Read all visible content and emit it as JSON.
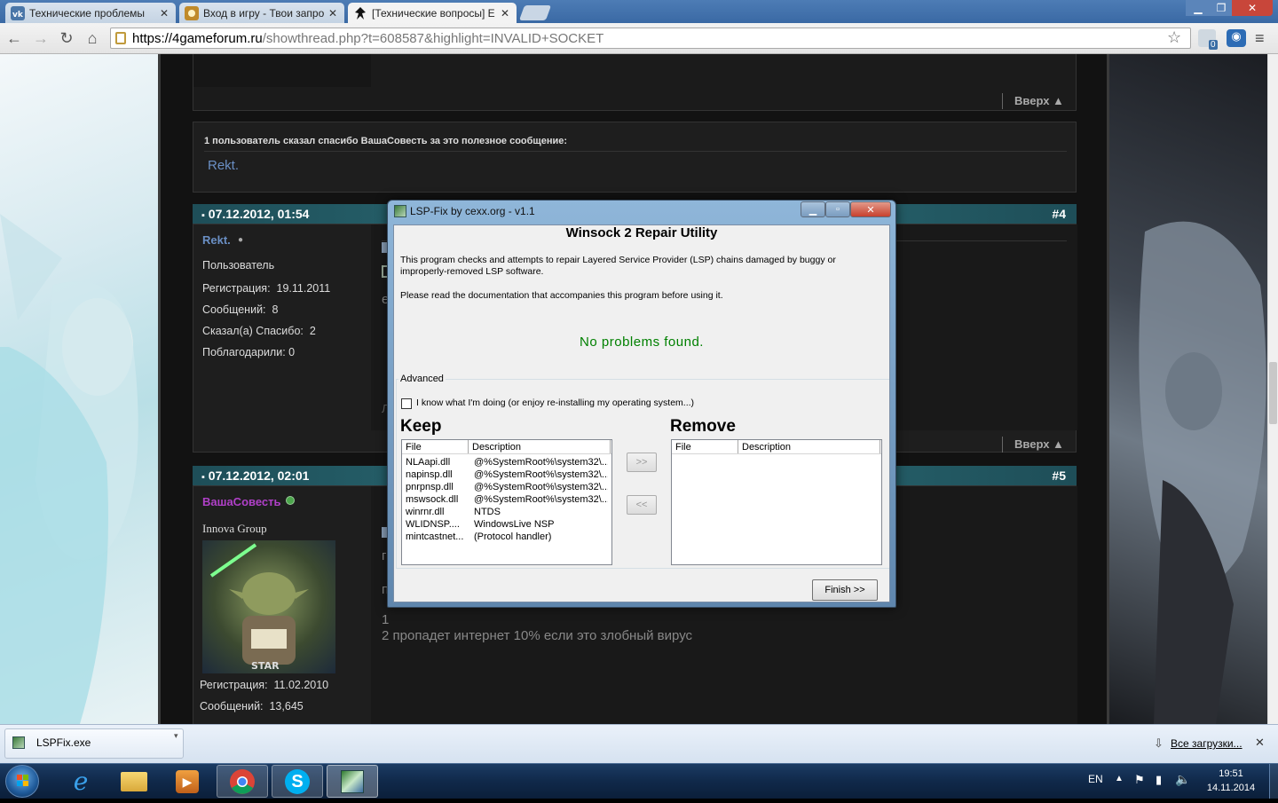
{
  "browser": {
    "tabs": [
      {
        "title": "Технические проблемы",
        "icon": "vk-icon",
        "active": false
      },
      {
        "title": "Вход в игру - Твои запро",
        "icon": "game-icon",
        "active": false
      },
      {
        "title": "[Технические вопросы] Е",
        "icon": "forum-icon",
        "active": true
      }
    ],
    "url_host": "https://4gameforum.ru",
    "url_rest": "/showthread.php?t=608587&highlight=INVALID+SOCKET",
    "ext_badge": "0"
  },
  "forum": {
    "top_back_link": "Вверх ▲",
    "thanks_header": "1 пользователь сказал спасибо ВашаСовесть за это полезное сообщение:",
    "thanks_user": "Rekt.",
    "post4": {
      "date": "07.12.2012, 01:54",
      "number": "#4",
      "author": "Rekt.",
      "role": "Пользователь",
      "reg_label": "Регистрация:",
      "reg_value": "19.11.2011",
      "msgs_label": "Сообщений:",
      "msgs_value": "8",
      "said_label": "Сказал(а) Спасибо:",
      "said_value": "2",
      "thanked_label": "Поблагодарили:",
      "thanked_value": "0",
      "back_link": "Вверх ▲",
      "text_e": "е",
      "text_l": "Л"
    },
    "post5": {
      "date": "07.12.2012, 02:01",
      "number": "#5",
      "author": "ВашаСовесть",
      "group": "Innova Group",
      "reg_label": "Регистрация:",
      "reg_value": "11.02.2010",
      "msgs_label": "Сообщений:",
      "msgs_value": "13,645",
      "text_g": "г",
      "text_p": "п",
      "text_1": "1",
      "text_2": "2 пропадет интернет 10% если это злобный вирус"
    }
  },
  "dialog": {
    "title": "LSP-Fix by cexx.org - v1.1",
    "heading": "Winsock 2 Repair Utility",
    "intro": "This program checks and attempts to repair Layered Service Provider (LSP) chains damaged by buggy or improperly-removed LSP software.",
    "read_doc": "Please read the documentation that accompanies this program before using it.",
    "status": "No problems found.",
    "advanced_label": "Advanced",
    "checkbox_label": "I know what I'm doing (or enjoy re-installing my operating system...)",
    "keep_label": "Keep",
    "remove_label": "Remove",
    "col_file": "File",
    "col_desc": "Description",
    "keep_rows": [
      {
        "file": "NLAapi.dll",
        "desc": "@%SystemRoot%\\system32\\..."
      },
      {
        "file": "napinsp.dll",
        "desc": "@%SystemRoot%\\system32\\..."
      },
      {
        "file": "pnrpnsp.dll",
        "desc": "@%SystemRoot%\\system32\\..."
      },
      {
        "file": "mswsock.dll",
        "desc": "@%SystemRoot%\\system32\\..."
      },
      {
        "file": "winrnr.dll",
        "desc": "NTDS"
      },
      {
        "file": "WLIDNSP....",
        "desc": "WindowsLive NSP"
      },
      {
        "file": "mintcastnet...",
        "desc": "(Protocol handler)"
      }
    ],
    "move_right": ">>",
    "move_left": "<<",
    "finish": "Finish >>"
  },
  "downloads": {
    "file": "LSPFix.exe",
    "all_link": "Все загрузки..."
  },
  "taskbar": {
    "lang": "EN",
    "time": "19:51",
    "date": "14.11.2014"
  },
  "colors": {
    "status_green": "#008000",
    "post_bar": "#2c6f79",
    "author_blue": "#6a8fc4",
    "author_magenta": "#b040c8"
  }
}
